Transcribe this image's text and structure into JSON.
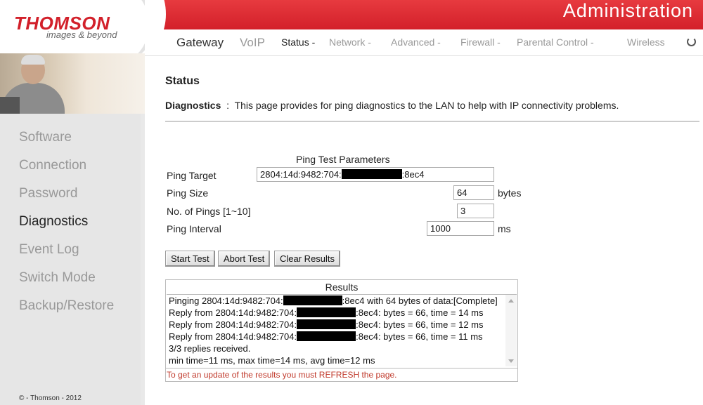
{
  "brand": {
    "name": "THOMSON",
    "tagline": "images & beyond"
  },
  "header": {
    "title": "Administration"
  },
  "tabs": {
    "gateway": "Gateway",
    "voip": "VoIP",
    "items": [
      {
        "label": "Status -",
        "active": true
      },
      {
        "label": "Network -",
        "active": false
      },
      {
        "label": "Advanced -",
        "active": false
      },
      {
        "label": "Firewall -",
        "active": false
      },
      {
        "label": "Parental Control -",
        "active": false
      },
      {
        "label": "Wireless",
        "active": false
      }
    ]
  },
  "sidebar": {
    "items": [
      {
        "label": "Software",
        "active": false
      },
      {
        "label": "Connection",
        "active": false
      },
      {
        "label": "Password",
        "active": false
      },
      {
        "label": "Diagnostics",
        "active": true
      },
      {
        "label": "Event Log",
        "active": false
      },
      {
        "label": "Switch Mode",
        "active": false
      },
      {
        "label": "Backup/Restore",
        "active": false
      }
    ],
    "copyright": "© - Thomson - 2012"
  },
  "page": {
    "title": "Status",
    "section_label": "Diagnostics",
    "section_sep": ":",
    "description": "This page provides for ping diagnostics to the LAN to help with IP connectivity problems."
  },
  "ping": {
    "params_title": "Ping Test Parameters",
    "target_label": "Ping Target",
    "target_prefix": "2804:14d:9482:704:",
    "target_suffix": ":8ec4",
    "size_label": "Ping Size",
    "size_value": "64",
    "size_unit": "bytes",
    "count_label": "No. of Pings [1~10]",
    "count_value": "3",
    "interval_label": "Ping Interval",
    "interval_value": "1000",
    "interval_unit": "ms"
  },
  "buttons": {
    "start": "Start Test",
    "abort": "Abort Test",
    "clear": "Clear Results"
  },
  "results": {
    "title": "Results",
    "lines": [
      {
        "prefix": "Pinging 2804:14d:9482:704:",
        "suffix": ":8ec4 with 64 bytes of data:[Complete]"
      },
      {
        "prefix": "Reply from 2804:14d:9482:704:",
        "suffix": ":8ec4: bytes = 66, time = 14 ms"
      },
      {
        "prefix": "Reply from 2804:14d:9482:704:",
        "suffix": ":8ec4: bytes = 66, time = 12 ms"
      },
      {
        "prefix": "Reply from 2804:14d:9482:704:",
        "suffix": ":8ec4: bytes = 66, time = 11 ms"
      },
      {
        "prefix": "3/3 replies received.",
        "suffix": ""
      },
      {
        "prefix": "min time=11 ms, max time=14 ms, avg time=12 ms",
        "suffix": ""
      }
    ],
    "note": "To get an update of the results you must REFRESH the page."
  },
  "colors": {
    "brand_red": "#d3202a",
    "note_red": "#c0392b"
  }
}
